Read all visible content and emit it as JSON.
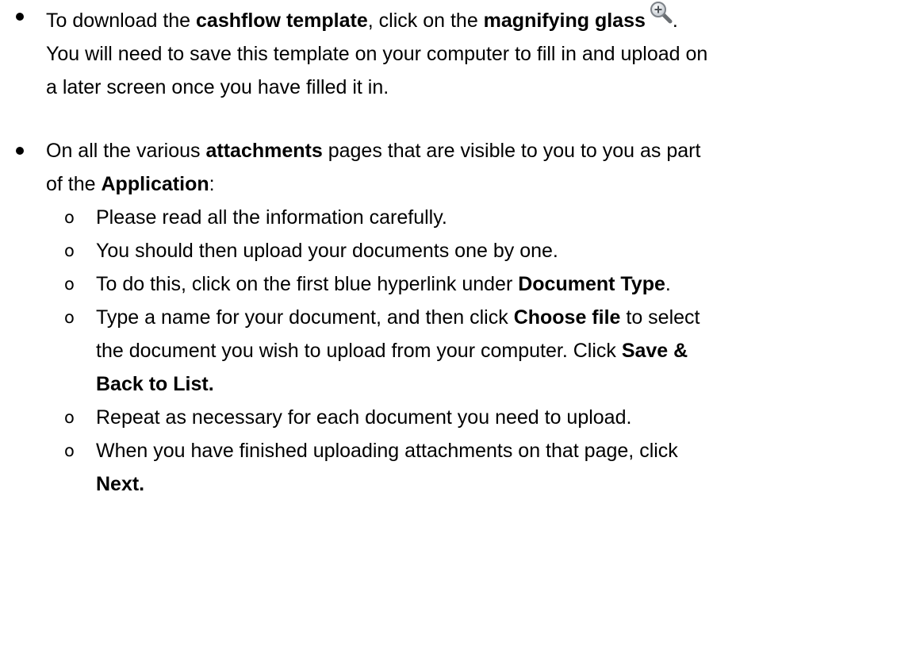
{
  "bullet1": {
    "pre": "To download the ",
    "b1": "cashflow template",
    "mid": ", click on the ",
    "b2": "magnifying glass",
    "post": ".",
    "line2": "You will need to save this template on your computer to fill in and upload on",
    "line3": "a later screen once you have filled it in.",
    "icon": "magnifying-glass-zoom-in-icon"
  },
  "bullet2": {
    "pre": "On all the various ",
    "b1": "attachments",
    "mid": " pages that are visible to you to you as part",
    "line2_pre": "of the ",
    "b2": "Application",
    "line2_post": ":",
    "sub_marker": "o",
    "sub": {
      "s1": "Please read all the information carefully.",
      "s2": "You should then upload your documents one by one.",
      "s3_pre": "To do this, click on the first blue hyperlink under ",
      "s3_b": "Document Type",
      "s3_post": ".",
      "s4_pre": "Type a name for your document, and then click ",
      "s4_b1": "Choose file",
      "s4_mid": " to select",
      "s4_line2": "the document you wish to upload from your computer. Click ",
      "s4_b2a": "Save &",
      "s4_b2b": "Back to List.",
      "s5": "Repeat as necessary for each document you need to upload.",
      "s6_line1": "When you have finished uploading attachments on that page, click",
      "s6_b": "Next."
    }
  }
}
